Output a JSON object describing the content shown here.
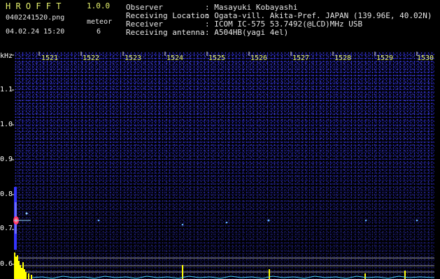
{
  "header": {
    "app_title": "H R O F F T",
    "version": "1.0.0",
    "filename": "0402241520.png",
    "datetime": "04.02.24 15:20",
    "meteor_label": "meteor",
    "meteor_count": "6",
    "observer_label": "Observer",
    "observer_value": ": Masayuki Kobayashi",
    "location_label": "Receiving Location",
    "location_value": ": Ogata-vill. Akita-Pref. JAPAN (139.96E, 40.02N)",
    "receiver_label": "Receiver",
    "receiver_value": ": ICOM IC-575 53.7492(@LCD)MHz USB",
    "antenna_label": "Receiving antenna",
    "antenna_value": ": A504HB(yagi 4el)"
  },
  "axes": {
    "y_unit": "kHz",
    "y_ticks": [
      "1.1",
      "1.0",
      "0.9",
      "0.8",
      "0.7",
      "0.6"
    ],
    "x_ticks": [
      "1521",
      "1522",
      "1523",
      "1524",
      "1525",
      "1526",
      "1527",
      "1528",
      "1529",
      "1530"
    ]
  },
  "colors": {
    "title": "#e8f46e",
    "noise": "#3b3bff",
    "signal_peak": "#ff3a6e",
    "spectrum": "#ffff00",
    "reference_lines": "#9a9a9a"
  }
}
